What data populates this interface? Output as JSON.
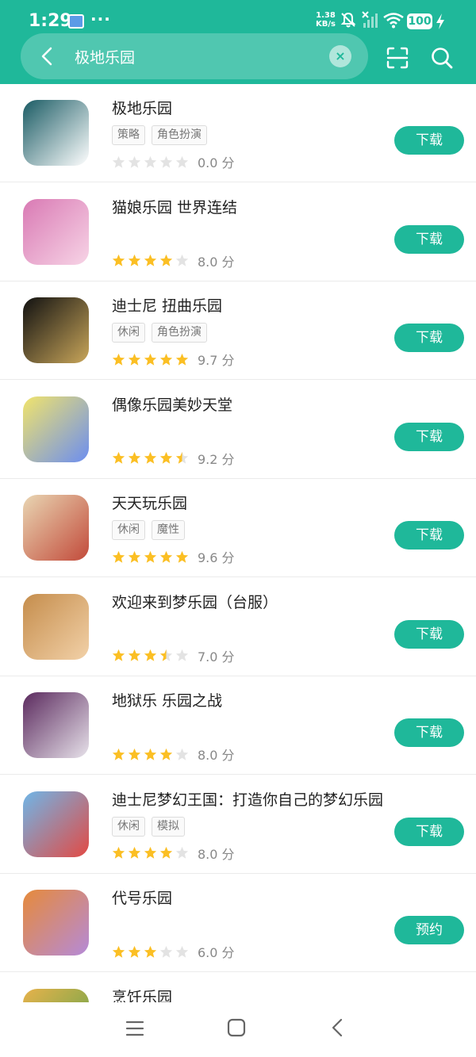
{
  "status": {
    "time": "1:29",
    "dots": "···",
    "speed_value": "1.38",
    "speed_unit": "KB/s",
    "battery": "100"
  },
  "search": {
    "query": "极地乐园",
    "clear_symbol": "×"
  },
  "colors": {
    "accent": "#1fb89a",
    "star": "#fbbf24",
    "star_empty": "#e3e3e3"
  },
  "apps": [
    {
      "name": "极地乐园",
      "tags": [
        "策略",
        "角色扮演"
      ],
      "rating": 0,
      "score": "0.0 分",
      "button": "下载"
    },
    {
      "name": "猫娘乐园 世界连结",
      "tags": [],
      "rating": 4,
      "score": "8.0 分",
      "button": "下载"
    },
    {
      "name": "迪士尼 扭曲乐园",
      "tags": [
        "休闲",
        "角色扮演"
      ],
      "rating": 5,
      "score": "9.7 分",
      "button": "下载"
    },
    {
      "name": "偶像乐园美妙天堂",
      "tags": [],
      "rating": 4.5,
      "score": "9.2 分",
      "button": "下载"
    },
    {
      "name": "天天玩乐园",
      "tags": [
        "休闲",
        "魔性"
      ],
      "rating": 5,
      "score": "9.6 分",
      "button": "下载"
    },
    {
      "name": "欢迎来到梦乐园（台服）",
      "tags": [],
      "rating": 3.5,
      "score": "7.0 分",
      "button": "下载"
    },
    {
      "name": "地狱乐 乐园之战",
      "tags": [],
      "rating": 4,
      "score": "8.0 分",
      "button": "下载"
    },
    {
      "name": "迪士尼梦幻王国：打造你自己的梦幻乐园",
      "tags": [
        "休闲",
        "模拟"
      ],
      "rating": 4,
      "score": "8.0 分",
      "button": "下载"
    },
    {
      "name": "代号乐园",
      "tags": [],
      "rating": 3,
      "score": "6.0 分",
      "button": "预约"
    },
    {
      "name": "烹饪乐园",
      "tags": [],
      "rating": 0,
      "score": "",
      "button": ""
    }
  ],
  "icons": {
    "status": [
      "notification-icon",
      "mute-bell-icon",
      "signal-icon",
      "wifi-icon",
      "battery-icon",
      "charging-icon"
    ],
    "header": [
      "back-icon",
      "scan-icon",
      "search-icon"
    ],
    "nav": [
      "menu-icon",
      "home-icon",
      "back-icon"
    ]
  }
}
